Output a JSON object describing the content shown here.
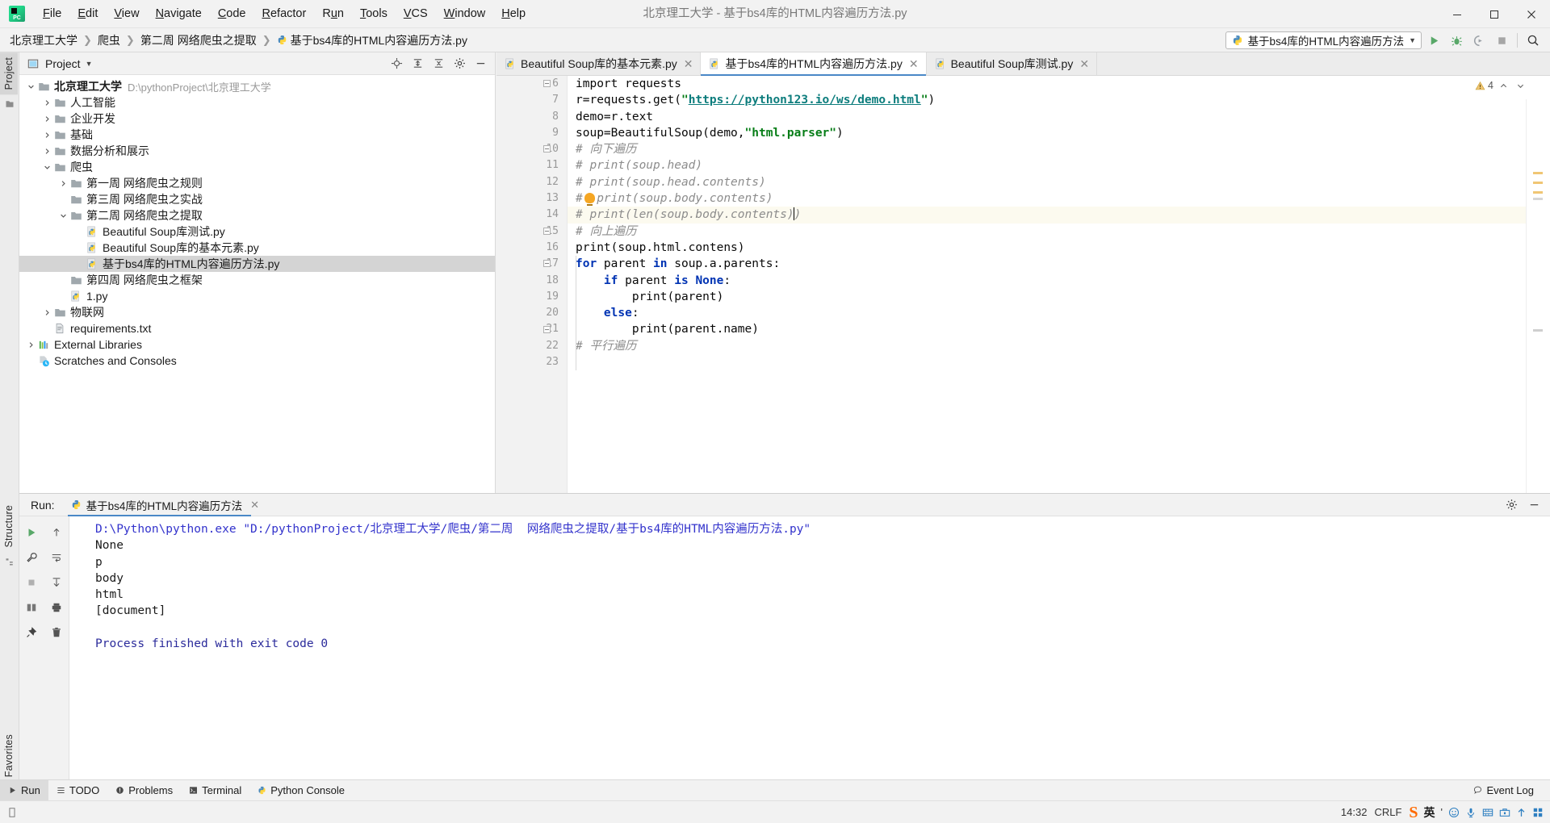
{
  "window": {
    "title": "北京理工大学 - 基于bs4库的HTML内容遍历方法.py",
    "minimize": "—",
    "maximize": "▢",
    "close": "✕"
  },
  "menubar": {
    "items": [
      {
        "label": "File",
        "mnemonic": "F"
      },
      {
        "label": "Edit",
        "mnemonic": "E"
      },
      {
        "label": "View",
        "mnemonic": "V"
      },
      {
        "label": "Navigate",
        "mnemonic": "N"
      },
      {
        "label": "Code",
        "mnemonic": "C"
      },
      {
        "label": "Refactor",
        "mnemonic": "R"
      },
      {
        "label": "Run",
        "mnemonic": "u"
      },
      {
        "label": "Tools",
        "mnemonic": "T"
      },
      {
        "label": "VCS",
        "mnemonic": "V"
      },
      {
        "label": "Window",
        "mnemonic": "W"
      },
      {
        "label": "Help",
        "mnemonic": "H"
      }
    ]
  },
  "breadcrumb": {
    "separator": "❯",
    "items": [
      "北京理工大学",
      "爬虫",
      "第二周 网络爬虫之提取",
      "基于bs4库的HTML内容遍历方法.py"
    ]
  },
  "toolbar": {
    "run_config": "基于bs4库的HTML内容遍历方法",
    "dropdown_arrow": "▼",
    "buttons": [
      "run-button",
      "debug-button",
      "run-coverage-button",
      "stop-button",
      "search-everywhere-button"
    ]
  },
  "left_strip": {
    "project_tab": "Project",
    "structure_tab": "Structure",
    "favorites_tab": "Favorites"
  },
  "project_panel": {
    "header_title": "Project",
    "header_arrow": "▼",
    "tree": [
      {
        "depth": 0,
        "arrow": "v",
        "icon": "folder-icon",
        "label": "北京理工大学",
        "bold": true,
        "path": "D:\\pythonProject\\北京理工大学",
        "selected": false
      },
      {
        "depth": 1,
        "arrow": ">",
        "icon": "folder-icon",
        "label": "人工智能",
        "bold": false,
        "path": "",
        "selected": false
      },
      {
        "depth": 1,
        "arrow": ">",
        "icon": "folder-icon",
        "label": "企业开发",
        "bold": false,
        "path": "",
        "selected": false
      },
      {
        "depth": 1,
        "arrow": ">",
        "icon": "folder-icon",
        "label": "基础",
        "bold": false,
        "path": "",
        "selected": false
      },
      {
        "depth": 1,
        "arrow": ">",
        "icon": "folder-icon",
        "label": "数据分析和展示",
        "bold": false,
        "path": "",
        "selected": false
      },
      {
        "depth": 1,
        "arrow": "v",
        "icon": "folder-icon",
        "label": "爬虫",
        "bold": false,
        "path": "",
        "selected": false
      },
      {
        "depth": 2,
        "arrow": ">",
        "icon": "folder-icon",
        "label": "第一周 网络爬虫之规则",
        "bold": false,
        "path": "",
        "selected": false
      },
      {
        "depth": 2,
        "arrow": "",
        "icon": "folder-icon",
        "label": "第三周 网络爬虫之实战",
        "bold": false,
        "path": "",
        "selected": false
      },
      {
        "depth": 2,
        "arrow": "v",
        "icon": "folder-icon",
        "label": "第二周 网络爬虫之提取",
        "bold": false,
        "path": "",
        "selected": false
      },
      {
        "depth": 3,
        "arrow": "",
        "icon": "python-file-icon",
        "label": "Beautiful Soup库测试.py",
        "bold": false,
        "path": "",
        "selected": false
      },
      {
        "depth": 3,
        "arrow": "",
        "icon": "python-file-icon",
        "label": "Beautiful  Soup库的基本元素.py",
        "bold": false,
        "path": "",
        "selected": false
      },
      {
        "depth": 3,
        "arrow": "",
        "icon": "python-file-icon",
        "label": "基于bs4库的HTML内容遍历方法.py",
        "bold": false,
        "path": "",
        "selected": true
      },
      {
        "depth": 2,
        "arrow": "",
        "icon": "folder-icon",
        "label": "第四周 网络爬虫之框架",
        "bold": false,
        "path": "",
        "selected": false
      },
      {
        "depth": 2,
        "arrow": "",
        "icon": "python-file-icon",
        "label": "1.py",
        "bold": false,
        "path": "",
        "selected": false
      },
      {
        "depth": 1,
        "arrow": ">",
        "icon": "folder-icon",
        "label": "物联网",
        "bold": false,
        "path": "",
        "selected": false
      },
      {
        "depth": 1,
        "arrow": "",
        "icon": "text-file-icon",
        "label": "requirements.txt",
        "bold": false,
        "path": "",
        "selected": false
      },
      {
        "depth": 0,
        "arrow": ">",
        "icon": "libraries-icon",
        "label": "External Libraries",
        "bold": false,
        "path": "",
        "selected": false
      },
      {
        "depth": 0,
        "arrow": "",
        "icon": "scratches-icon",
        "label": "Scratches and Consoles",
        "bold": false,
        "path": "",
        "selected": false
      }
    ]
  },
  "editor": {
    "tabs": [
      {
        "label": "Beautiful  Soup库的基本元素.py",
        "active": false,
        "close": "✕"
      },
      {
        "label": "基于bs4库的HTML内容遍历方法.py",
        "active": true,
        "close": "✕"
      },
      {
        "label": "Beautiful Soup库测试.py",
        "active": false,
        "close": "✕"
      }
    ],
    "inspection_count": "4",
    "inspection_icon": "warning-triangle-icon",
    "first_line_number": 6,
    "caret_line": 14,
    "lines": [
      {
        "n": 6,
        "tokens": [
          {
            "t": "import requests",
            "c": "pln"
          }
        ]
      },
      {
        "n": 7,
        "tokens": [
          {
            "t": "r=requests.get(",
            "c": "pln"
          },
          {
            "t": "\"",
            "c": "str"
          },
          {
            "t": "https://python123.io/ws/demo.html",
            "c": "url"
          },
          {
            "t": "\"",
            "c": "str"
          },
          {
            "t": ")",
            "c": "pln"
          }
        ]
      },
      {
        "n": 8,
        "tokens": [
          {
            "t": "demo=r.text",
            "c": "pln"
          }
        ]
      },
      {
        "n": 9,
        "tokens": [
          {
            "t": "soup=BeautifulSoup(demo,",
            "c": "pln"
          },
          {
            "t": "\"html.parser\"",
            "c": "str"
          },
          {
            "t": ")",
            "c": "pln"
          }
        ]
      },
      {
        "n": 10,
        "tokens": [
          {
            "t": "# 向下遍历",
            "c": "com"
          }
        ]
      },
      {
        "n": 11,
        "tokens": [
          {
            "t": "# print(soup.head)",
            "c": "com"
          }
        ]
      },
      {
        "n": 12,
        "tokens": [
          {
            "t": "# print(soup.head.contents)",
            "c": "com"
          }
        ]
      },
      {
        "n": 13,
        "tokens": [
          {
            "t": "#  print(soup.body.contents)",
            "c": "com"
          }
        ]
      },
      {
        "n": 14,
        "tokens": [
          {
            "t": "# print(len(soup.body.contents)",
            "c": "com"
          },
          {
            "t": "CARET",
            "c": "caret"
          },
          {
            "t": ")",
            "c": "com"
          }
        ]
      },
      {
        "n": 15,
        "tokens": [
          {
            "t": "# 向上遍历",
            "c": "com"
          }
        ]
      },
      {
        "n": 16,
        "tokens": [
          {
            "t": "print(soup.html.contens)",
            "c": "pln"
          }
        ]
      },
      {
        "n": 17,
        "tokens": [
          {
            "t": "for",
            "c": "kw"
          },
          {
            "t": " parent ",
            "c": "pln"
          },
          {
            "t": "in",
            "c": "kw"
          },
          {
            "t": " soup.a.parents:",
            "c": "pln"
          }
        ]
      },
      {
        "n": 18,
        "tokens": [
          {
            "t": "    ",
            "c": "pln"
          },
          {
            "t": "if",
            "c": "kw"
          },
          {
            "t": " parent ",
            "c": "pln"
          },
          {
            "t": "is",
            "c": "kw"
          },
          {
            "t": " ",
            "c": "pln"
          },
          {
            "t": "None",
            "c": "kw"
          },
          {
            "t": ":",
            "c": "pln"
          }
        ]
      },
      {
        "n": 19,
        "tokens": [
          {
            "t": "        print(parent)",
            "c": "pln"
          }
        ]
      },
      {
        "n": 20,
        "tokens": [
          {
            "t": "    ",
            "c": "pln"
          },
          {
            "t": "else",
            "c": "kw"
          },
          {
            "t": ":",
            "c": "pln"
          }
        ]
      },
      {
        "n": 21,
        "tokens": [
          {
            "t": "        print(parent.name)",
            "c": "pln"
          }
        ]
      },
      {
        "n": 22,
        "tokens": [
          {
            "t": "# 平行遍历",
            "c": "com"
          }
        ]
      },
      {
        "n": 23,
        "tokens": [
          {
            "t": "",
            "c": "pln"
          }
        ]
      }
    ]
  },
  "run_panel": {
    "label": "Run:",
    "tab_label": "基于bs4库的HTML内容遍历方法",
    "tab_close": "✕",
    "settings_icon": "gear-icon",
    "minimize_icon": "minimize-icon",
    "side_buttons": [
      "rerun-button",
      "scroll-up-button",
      "settings-wrench-button",
      "soft-wrap-button",
      "stop-button",
      "scroll-down-button",
      "print-button",
      "clear-all-button"
    ],
    "output": [
      {
        "text": "D:\\Python\\python.exe \"D:/pythonProject/北京理工大学/爬虫/第二周  网络爬虫之提取/基于bs4库的HTML内容遍历方法.py\"",
        "cls": "cmdline"
      },
      {
        "text": "None",
        "cls": "outline"
      },
      {
        "text": "p",
        "cls": "outline"
      },
      {
        "text": "body",
        "cls": "outline"
      },
      {
        "text": "html",
        "cls": "outline"
      },
      {
        "text": "[document]",
        "cls": "outline"
      },
      {
        "text": "",
        "cls": "outline"
      },
      {
        "text": "Process finished with exit code 0",
        "cls": "finline"
      }
    ]
  },
  "toolwindow_bar": {
    "items": [
      {
        "label": "Run",
        "icon": "run-icon",
        "active": true
      },
      {
        "label": "TODO",
        "icon": "todo-icon",
        "active": false
      },
      {
        "label": "Problems",
        "icon": "problems-icon",
        "active": false
      },
      {
        "label": "Terminal",
        "icon": "terminal-icon",
        "active": false
      },
      {
        "label": "Python Console",
        "icon": "python-console-icon",
        "active": false
      }
    ],
    "event_log": "Event Log",
    "event_log_icon": "balloon-icon"
  },
  "statusbar": {
    "time": "14:32",
    "line_separator": "CRLF",
    "tray": [
      "sogou-ime-icon",
      "english-mode-icon",
      "comma-icon",
      "smiley-icon",
      "mic-icon",
      "keyboard-icon",
      "toolbox-icon",
      "up-arrow-icon",
      "grid-icon"
    ],
    "ime_mode": "英",
    "memory_icon": "memory-indicator"
  },
  "colors": {
    "accent": "#4a88c7",
    "run_green": "#59a869",
    "warning": "#f5a623",
    "string_green": "#067d17",
    "keyword_blue": "#0033b3",
    "comment_gray": "#8c8c8c",
    "url_teal": "#0d7d7d",
    "console_blue": "#2b2b9b",
    "selection_gray": "#d4d4d4",
    "sogou_orange": "#ff6a00"
  }
}
